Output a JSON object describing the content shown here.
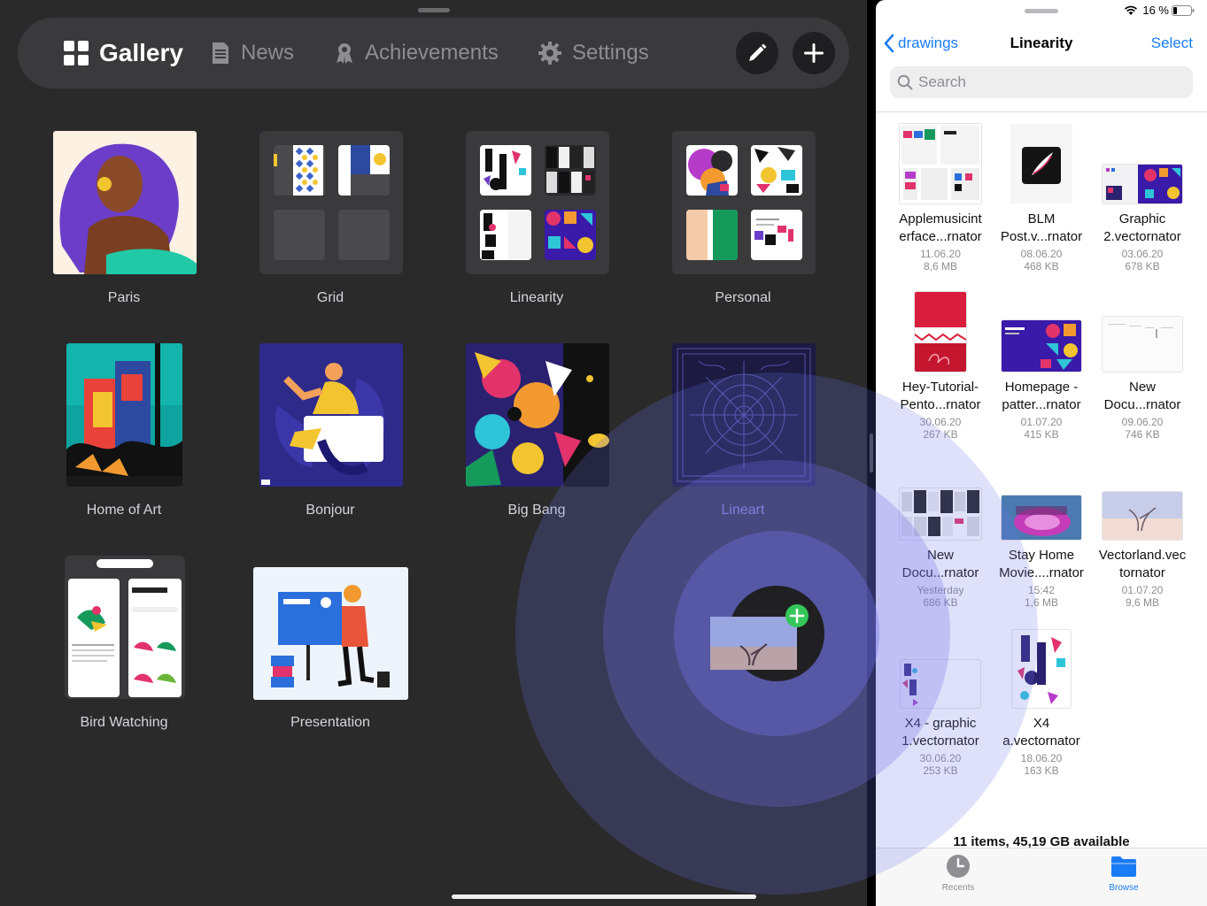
{
  "status": {
    "battery": "16 %"
  },
  "nav": {
    "tabs": [
      {
        "label": "Gallery",
        "icon": "grid-icon"
      },
      {
        "label": "News",
        "icon": "newspaper-icon"
      },
      {
        "label": "Achievements",
        "icon": "ribbon-icon"
      },
      {
        "label": "Settings",
        "icon": "gear-icon"
      }
    ],
    "edit_icon": "pencil-icon",
    "add_icon": "plus-icon"
  },
  "gallery": [
    {
      "label": "Paris"
    },
    {
      "label": "Grid"
    },
    {
      "label": "Linearity"
    },
    {
      "label": "Personal"
    },
    {
      "label": "Home of Art"
    },
    {
      "label": "Bonjour"
    },
    {
      "label": "Big Bang"
    },
    {
      "label": "Lineart"
    },
    {
      "label": "Bird Watching"
    },
    {
      "label": "Presentation"
    }
  ],
  "files": {
    "back_label": "drawings",
    "title": "Linearity",
    "select_label": "Select",
    "search_placeholder": "Search",
    "items": [
      {
        "name1": "Applemusicint",
        "name2": "erface...rnator",
        "date": "11.06.20",
        "size": "8,6 MB"
      },
      {
        "name1": "BLM",
        "name2": "Post.v...rnator",
        "date": "08.06.20",
        "size": "468 KB"
      },
      {
        "name1": "Graphic",
        "name2": "2.vectornator",
        "date": "03.06.20",
        "size": "678 KB"
      },
      {
        "name1": "Hey-Tutorial-",
        "name2": "Pento...rnator",
        "date": "30.06.20",
        "size": "267 KB"
      },
      {
        "name1": "Homepage -",
        "name2": "patter...rnator",
        "date": "01.07.20",
        "size": "415 KB"
      },
      {
        "name1": "New",
        "name2": "Docu...rnator",
        "date": "09.06.20",
        "size": "746 KB"
      },
      {
        "name1": "New",
        "name2": "Docu...rnator",
        "date": "Yesterday",
        "size": "686 KB"
      },
      {
        "name1": "Stay Home",
        "name2": "Movie....rnator",
        "date": "15:42",
        "size": "1,6 MB"
      },
      {
        "name1": "Vectorland.vec",
        "name2": "tornator",
        "date": "01.07.20",
        "size": "9,6 MB"
      },
      {
        "name1": "X4 - graphic",
        "name2": "1.vectornator",
        "date": "30.06.20",
        "size": "253 KB"
      },
      {
        "name1": "X4",
        "name2": "a.vectornator",
        "date": "18.06.20",
        "size": "163 KB"
      }
    ],
    "footer": "11 items, 45,19 GB available",
    "tabs": [
      {
        "label": "Recents"
      },
      {
        "label": "Browse"
      }
    ]
  },
  "colors": {
    "accent": "#1a7cf5",
    "ripple": "#6e70e8",
    "drop_badge": "#34c759",
    "gallery_bg": "#2a2a2b"
  }
}
